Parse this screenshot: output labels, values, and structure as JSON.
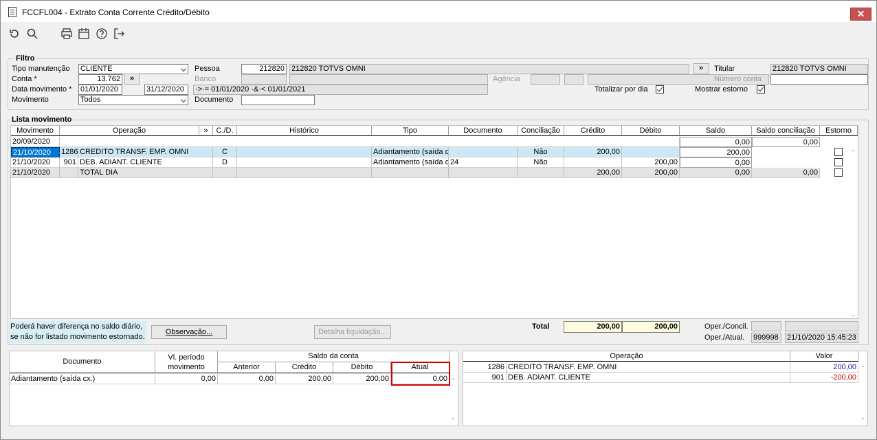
{
  "window": {
    "title": "FCCFL004 - Extrato Conta Corrente Crédito/Débito",
    "close": "✕"
  },
  "filtro": {
    "legend": "Filtro",
    "tipo_manutencao_label": "Tipo manutenção",
    "tipo_manutencao_value": "CLIENTE",
    "conta_label": "Conta *",
    "conta_value": "13.762",
    "more_btn": "»",
    "data_movimento_label": "Data movimento *",
    "data_inicio": "01/01/2020",
    "data_fim": "31/12/2020",
    "data_expr": "·>·= 01/01/2020 ·&·< 01/01/2021",
    "movimento_label": "Movimento",
    "movimento_value": "Todos",
    "pessoa_label": "Pessoa",
    "pessoa_value": "212820",
    "pessoa_nome": "212820   TOTVS OMNI",
    "banco_label": "Banco",
    "agencia_label": "Agência",
    "documento_label": "Documento",
    "documento_value": "",
    "titular_label": "Titular",
    "titular_value": "212820   TOTVS OMNI",
    "numero_conta_label": "Número conta",
    "totalizar_label": "Totalizar por dia",
    "totalizar_checked": true,
    "mostrar_estorno_label": "Mostrar estorno",
    "mostrar_estorno_checked": true
  },
  "lista": {
    "legend": "Lista movimento",
    "headers": [
      "Movimento",
      "Operação",
      "»",
      "C./D.",
      "Histórico",
      "Tipo",
      "Documento",
      "Conciliação",
      "Crédito",
      "Débito",
      "Saldo",
      "Saldo conciliação",
      "Estorno"
    ],
    "rows": [
      {
        "movimento": "20/09/2020",
        "op_cod": "",
        "op_nome": "",
        "cd": "",
        "historico": "",
        "tipo": "",
        "documento": "",
        "conciliacao": "",
        "credito": "",
        "debito": "",
        "saldo": "0,00",
        "saldo_conc": "0,00",
        "estorno": false
      },
      {
        "movimento": "21/10/2020",
        "op_cod": "1286",
        "op_nome": "CREDITO TRANSF. EMP. OMNI",
        "cd": "C",
        "historico": "",
        "tipo": "Adiantamento (saída cx.)",
        "documento": "",
        "conciliacao": "Não",
        "credito": "200,00",
        "debito": "",
        "saldo": "200,00",
        "saldo_conc": "",
        "estorno": false
      },
      {
        "movimento": "21/10/2020",
        "op_cod": "901",
        "op_nome": "DEB. ADIANT. CLIENTE",
        "cd": "D",
        "historico": "",
        "tipo": "Adiantamento (saída cx.)",
        "documento": "24",
        "conciliacao": "Não",
        "credito": "",
        "debito": "200,00",
        "saldo": "0,00",
        "saldo_conc": "",
        "estorno": false
      },
      {
        "movimento": "21/10/2020",
        "op_cod": "",
        "op_nome": "TOTAL DIA",
        "cd": "",
        "historico": "",
        "tipo": "",
        "documento": "",
        "conciliacao": "",
        "credito": "200,00",
        "debito": "200,00",
        "saldo": "0,00",
        "saldo_conc": "0,00",
        "estorno": false
      }
    ]
  },
  "footer": {
    "aviso": "Poderá haver diferença no saldo diário,\nse não for listado movimento estornado.",
    "observacao_btn": "Observação...",
    "detalha_btn": "Detalha liquidação...",
    "total_label": "Total",
    "total_credito": "200,00",
    "total_debito": "200,00",
    "oper_concil_label": "Oper./Concil.",
    "oper_atual_label": "Oper./Atual.",
    "oper_concil_1": "",
    "oper_concil_2": "",
    "oper_atual_1": "999998",
    "oper_atual_2": "21/10/2020 15:45:23"
  },
  "saldo_grid": {
    "h_documento": "Documento",
    "h_vl_periodo": "Vl. período\nmovimento",
    "h_saldo_conta": "Saldo da conta",
    "h_anterior": "Anterior",
    "h_credito": "Crédito",
    "h_debito": "Débito",
    "h_atual": "Atual",
    "row": {
      "documento": "Adiantamento (saída cx.)",
      "vl_periodo": "0,00",
      "anterior": "0,00",
      "credito": "200,00",
      "debito": "200,00",
      "atual": "0,00"
    }
  },
  "oper_grid": {
    "h_operacao": "Operação",
    "h_valor": "Valor",
    "rows": [
      {
        "cod": "1286",
        "nome": "CREDITO TRANSF. EMP. OMNI",
        "valor": "200,00",
        "color": "#1a1aa0"
      },
      {
        "cod": "901",
        "nome": "DEB. ADIANT. CLIENTE",
        "valor": "-200,00",
        "color": "#c00000"
      }
    ]
  },
  "colors": {
    "selected_row": "#cde8f4",
    "info_bg": "#d8eef5",
    "total_bg": "#fffbe0",
    "highlight": "#d00000"
  }
}
